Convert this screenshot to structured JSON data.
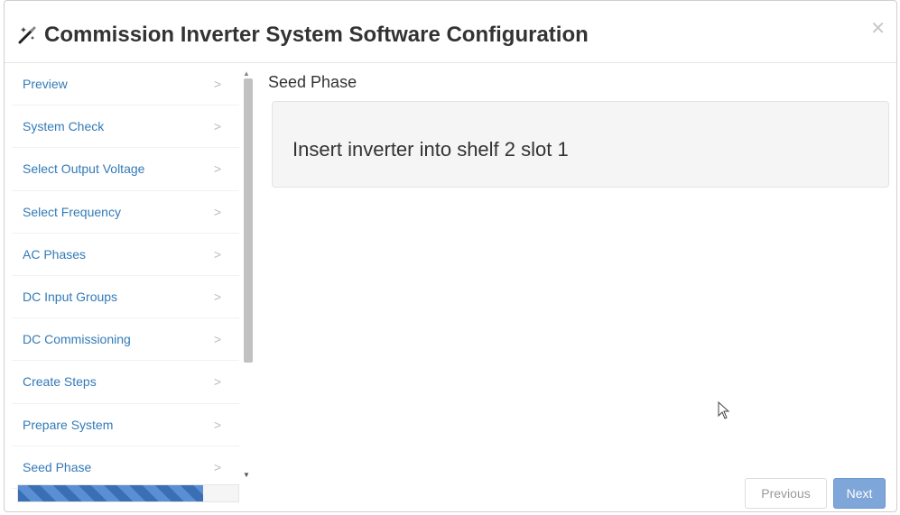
{
  "dialog": {
    "title": "Commission Inverter System Software Configuration",
    "icons": {
      "title_icon": "magic-wand-icon",
      "close_icon": "close-icon"
    },
    "close_label": "✕"
  },
  "sidebar": {
    "items": [
      {
        "label": "Preview",
        "chevron": ">"
      },
      {
        "label": "System Check",
        "chevron": ">"
      },
      {
        "label": "Select Output Voltage",
        "chevron": ">"
      },
      {
        "label": "Select Frequency",
        "chevron": ">"
      },
      {
        "label": "AC Phases",
        "chevron": ">"
      },
      {
        "label": "DC Input Groups",
        "chevron": ">"
      },
      {
        "label": "DC Commissioning",
        "chevron": ">"
      },
      {
        "label": "Create Steps",
        "chevron": ">"
      },
      {
        "label": "Prepare System",
        "chevron": ">"
      },
      {
        "label": "Seed Phase",
        "chevron": ">"
      }
    ],
    "progress_fraction": 0.84
  },
  "main": {
    "section_title": "Seed Phase",
    "instruction": "Insert inverter into shelf 2 slot 1"
  },
  "footer": {
    "previous_label": "Previous",
    "next_label": "Next"
  },
  "colors": {
    "link": "#337ab7",
    "primary_button": "#7ea6d8",
    "progress": "#3a6fb6"
  }
}
